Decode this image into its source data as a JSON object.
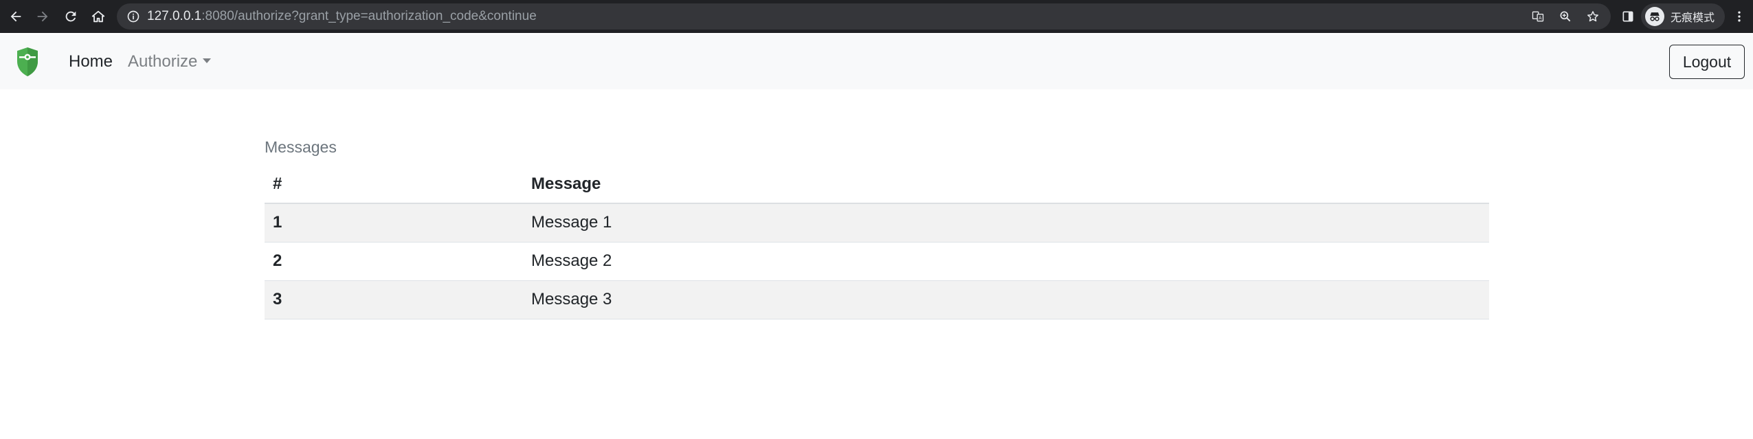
{
  "browser": {
    "url_host": "127.0.0.1",
    "url_rest": ":8080/authorize?grant_type=authorization_code&continue",
    "profile_label": "无痕模式"
  },
  "navbar": {
    "home_label": "Home",
    "authorize_label": "Authorize",
    "logout_label": "Logout"
  },
  "messages": {
    "title": "Messages",
    "columns": [
      "#",
      "Message"
    ],
    "rows": [
      {
        "num": "1",
        "message": "Message 1"
      },
      {
        "num": "2",
        "message": "Message 2"
      },
      {
        "num": "3",
        "message": "Message 3"
      }
    ]
  },
  "colors": {
    "brand_green": "#4caf50",
    "chrome_bg": "#202124",
    "navbar_bg": "#f8f9fa",
    "row_stripe": "#f2f2f2"
  },
  "icons": {
    "back": "arrow-left-icon",
    "forward": "arrow-right-icon",
    "reload": "reload-icon",
    "home": "home-icon",
    "info": "info-icon",
    "translate": "translate-icon",
    "zoom": "zoom-icon",
    "bookmark": "star-icon",
    "side_panel": "side-panel-icon",
    "incognito": "incognito-icon",
    "menu": "kebab-menu-icon",
    "brand": "shield-logo-icon"
  }
}
